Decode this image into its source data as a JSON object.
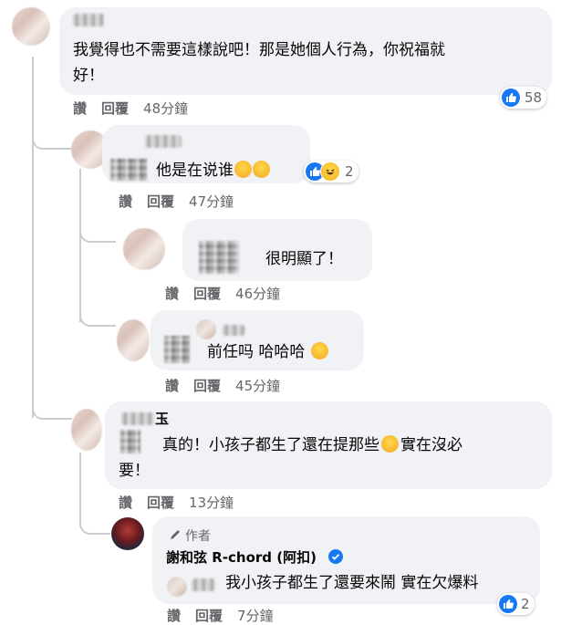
{
  "actions": {
    "like": "讚",
    "reply": "回覆"
  },
  "comments": [
    {
      "text_line1": "我覺得也不需要這樣說吧！那是她個人行為，你祝福就",
      "text_line2": "好！",
      "time": "48分鐘",
      "reaction_count": "58"
    },
    {
      "text": "他是在说谁",
      "time": "47分鐘",
      "reaction_count": "2"
    },
    {
      "text": "很明顯了！",
      "time": "46分鐘"
    },
    {
      "text": "前任吗 哈哈哈",
      "time": "45分鐘"
    },
    {
      "name_fragment": "玉",
      "text_line1": "真的！小孩子都生了還在提那些",
      "text_line1b": "實在沒必",
      "text_line2": "要！",
      "time": "13分鐘"
    },
    {
      "author_label": "作者",
      "author_name": "謝和弦 R-chord (阿扣)",
      "text": "我小孩子都生了還要來鬧 實在欠爆料",
      "time": "7分鐘",
      "reaction_count": "2"
    }
  ],
  "colors": {
    "like_blue": "#1877f2",
    "bubble_gray": "#f0f2f5",
    "meta_gray": "#65676b"
  }
}
